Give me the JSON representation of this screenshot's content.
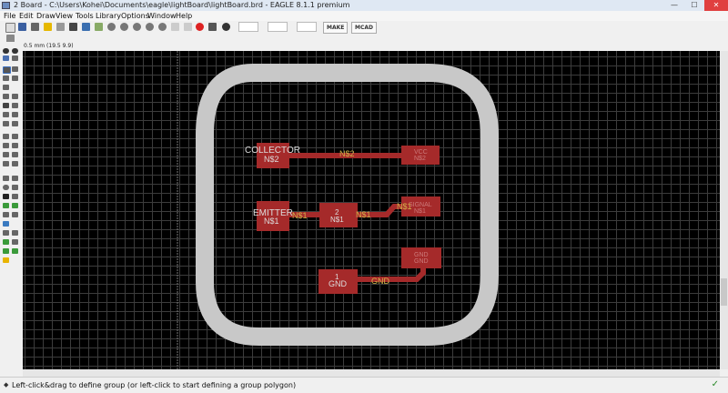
{
  "window": {
    "title": "2 Board - C:\\Users\\Kohei\\Documents\\eagle\\lightBoard\\lightBoard.brd - EAGLE 8.1.1 premium",
    "min_glyph": "—",
    "max_glyph": "☐",
    "close_glyph": "✕"
  },
  "menu": [
    "File",
    "Edit",
    "Draw",
    "View",
    "Tools",
    "Library",
    "Options",
    "Window",
    "Help"
  ],
  "toolbar": {
    "make_label": "MAKE",
    "mcad_label": "MCAD"
  },
  "coord_readout": "0.5 mm (19.5 9.9)",
  "board": {
    "parts": {
      "collector": {
        "name": "COLLECTOR",
        "net": "N$2"
      },
      "vcc": {
        "name": "VCC",
        "net": "N$2"
      },
      "emitter": {
        "name": "EMITTER",
        "net": "N$1"
      },
      "mid": {
        "name": "2",
        "net": "N$1"
      },
      "signal": {
        "name": "SIGNAL",
        "net": "N$1"
      },
      "gnd_top": {
        "name": "GND",
        "net": "GND"
      },
      "gnd_bottom": {
        "name": "1",
        "net": "GND"
      }
    },
    "trace_labels": {
      "n2": "N$2",
      "n1_a": "N$1",
      "n1_b": "N$1",
      "n1_c": "N$1",
      "gnd": "GND"
    },
    "colors": {
      "copper": "#a52a2a",
      "dimension": "#c8c8c8",
      "label": "#d4b44a"
    }
  },
  "status": {
    "message": "Left-click&drag to define group (or left-click to start defining a group polygon)"
  }
}
